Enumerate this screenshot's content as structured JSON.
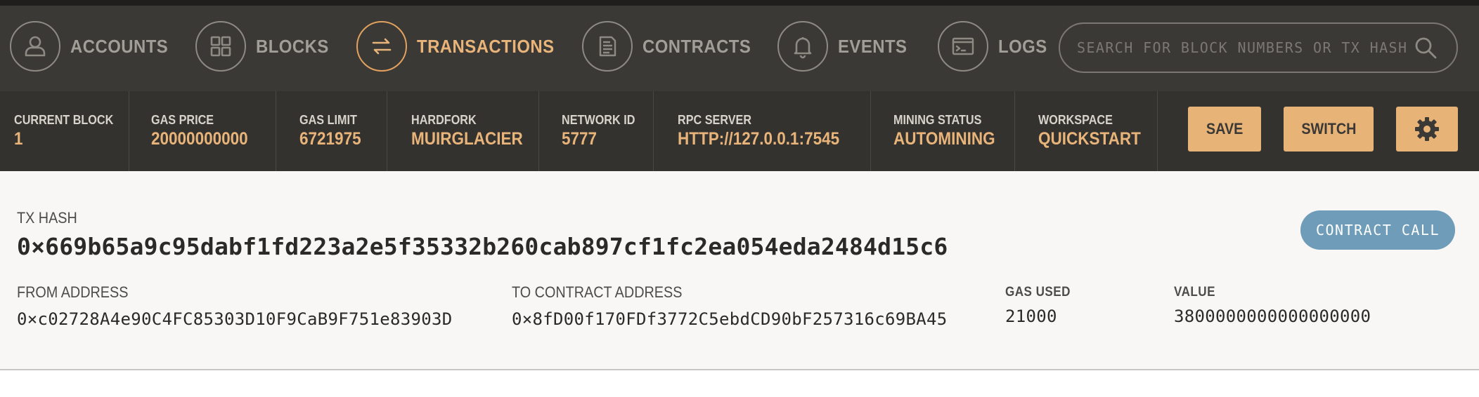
{
  "nav": {
    "items": [
      {
        "label": "ACCOUNTS",
        "icon": "user-icon"
      },
      {
        "label": "BLOCKS",
        "icon": "grid-icon"
      },
      {
        "label": "TRANSACTIONS",
        "icon": "arrows-icon"
      },
      {
        "label": "CONTRACTS",
        "icon": "document-icon"
      },
      {
        "label": "EVENTS",
        "icon": "bell-icon"
      },
      {
        "label": "LOGS",
        "icon": "terminal-icon"
      }
    ],
    "active": "TRANSACTIONS",
    "search_placeholder": "SEARCH FOR BLOCK NUMBERS OR TX HASHES"
  },
  "status": {
    "current_block": {
      "label": "CURRENT BLOCK",
      "value": "1"
    },
    "gas_price": {
      "label": "GAS PRICE",
      "value": "20000000000"
    },
    "gas_limit": {
      "label": "GAS LIMIT",
      "value": "6721975"
    },
    "hardfork": {
      "label": "HARDFORK",
      "value": "MUIRGLACIER"
    },
    "network_id": {
      "label": "NETWORK ID",
      "value": "5777"
    },
    "rpc_server": {
      "label": "RPC SERVER",
      "value": "HTTP://127.0.0.1:7545"
    },
    "mining_status": {
      "label": "MINING STATUS",
      "value": "AUTOMINING"
    },
    "workspace": {
      "label": "WORKSPACE",
      "value": "QUICKSTART"
    },
    "save_label": "SAVE",
    "switch_label": "SWITCH"
  },
  "transaction": {
    "hash_label": "TX HASH",
    "hash": "0×669b65a9c95dabf1fd223a2e5f35332b260cab897cf1fc2ea054eda2484d15c6",
    "type_badge": "CONTRACT CALL",
    "from_label": "FROM ADDRESS",
    "from": "0×c02728A4e90C4FC85303D10F9CaB9F751e83903D",
    "to_label": "TO CONTRACT ADDRESS",
    "to": "0×8fD00f170FDf3772C5ebdCD90bF257316c69BA45",
    "gas_used_label": "GAS USED",
    "gas_used": "21000",
    "value_label": "VALUE",
    "value": "3800000000000000000"
  },
  "colors": {
    "nav_bg": "#3b3935",
    "status_bg": "#34322f",
    "accent": "#e8b47a",
    "badge": "#6f9cb8"
  }
}
